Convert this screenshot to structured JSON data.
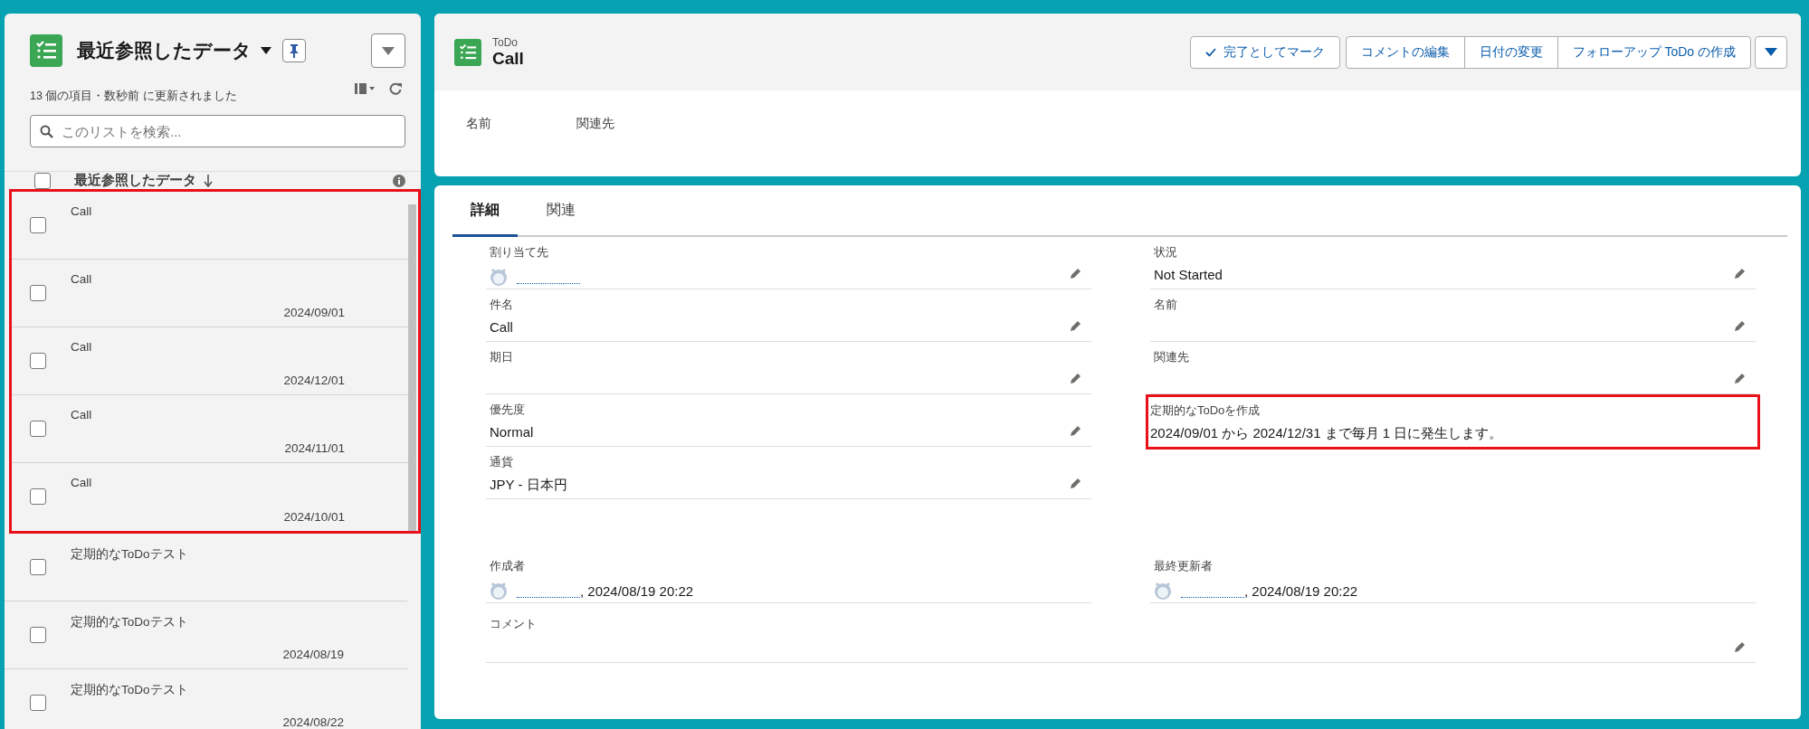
{
  "list_panel": {
    "title": "最近参照したデータ",
    "subtitle": "13 個の項目・数秒前 に更新されました",
    "search": {
      "placeholder": "このリストを検索..."
    },
    "column_header": "最近参照したデータ",
    "select_all_checked": false,
    "rows": [
      {
        "title": "Call",
        "checked": false,
        "highlighted": true
      },
      {
        "title": "Call",
        "date": "2024/09/01",
        "checked": false,
        "highlighted": true
      },
      {
        "title": "Call",
        "date": "2024/12/01",
        "checked": false,
        "highlighted": true
      },
      {
        "title": "Call",
        "date": "2024/11/01",
        "checked": false,
        "highlighted": true
      },
      {
        "title": "Call",
        "date": "2024/10/01",
        "checked": false,
        "highlighted": true
      },
      {
        "title": "定期的なToDoテスト",
        "checked": false,
        "highlighted": false
      },
      {
        "title": "定期的なToDoテスト",
        "date": "2024/08/19",
        "checked": false,
        "highlighted": false
      },
      {
        "title": "定期的なToDoテスト",
        "date": "2024/08/22",
        "checked": false,
        "highlighted": false
      }
    ]
  },
  "record": {
    "object_type": "ToDo",
    "title": "Call",
    "actions": [
      {
        "label": "完了としてマーク",
        "kind": "check"
      },
      {
        "label": "コメントの編集",
        "kind": "plain"
      },
      {
        "label": "日付の変更",
        "kind": "plain"
      },
      {
        "label": "フォローアップ ToDo の作成",
        "kind": "plain"
      }
    ],
    "highlights": [
      {
        "label": "名前"
      },
      {
        "label": "関連先"
      }
    ]
  },
  "detail": {
    "tabs": [
      {
        "label": "詳細",
        "selected": true
      },
      {
        "label": "関連",
        "selected": false
      }
    ],
    "sections": [
      {
        "fields": [
          {
            "label": "割り当て先",
            "kind": "user",
            "editable": true,
            "highlighted": false,
            "wide": false
          },
          {
            "label": "状況",
            "value": "Not Started",
            "kind": "text",
            "editable": true,
            "highlighted": false,
            "wide": false
          },
          {
            "label": "件名",
            "value": "Call",
            "kind": "text",
            "editable": true,
            "highlighted": false,
            "wide": false
          },
          {
            "label": "名前",
            "kind": "text",
            "editable": true,
            "highlighted": false,
            "wide": false
          },
          {
            "label": "期日",
            "kind": "text",
            "editable": true,
            "highlighted": false,
            "wide": false
          },
          {
            "label": "関連先",
            "kind": "text",
            "editable": true,
            "highlighted": false,
            "wide": false
          },
          {
            "label": "優先度",
            "value": "Normal",
            "kind": "text",
            "editable": true,
            "highlighted": false,
            "wide": false
          },
          {
            "label": "定期的なToDoを作成",
            "value": "2024/09/01 から 2024/12/31 まで毎月 1 日に発生します。",
            "kind": "text",
            "editable": false,
            "highlighted": true,
            "wide": false
          },
          {
            "label": "通貨",
            "value": "JPY - 日本円",
            "kind": "text",
            "editable": true,
            "highlighted": false,
            "wide": false
          }
        ]
      },
      {
        "fields": [
          {
            "label": "作成者",
            "value": ", 2024/08/19 20:22",
            "kind": "user",
            "editable": false,
            "highlighted": false,
            "wide": false
          },
          {
            "label": "最終更新者",
            "value": ", 2024/08/19 20:22",
            "kind": "user",
            "editable": false,
            "highlighted": false,
            "wide": false
          },
          {
            "label": "コメント",
            "kind": "text",
            "editable": true,
            "highlighted": false,
            "wide": true
          }
        ]
      }
    ]
  }
}
